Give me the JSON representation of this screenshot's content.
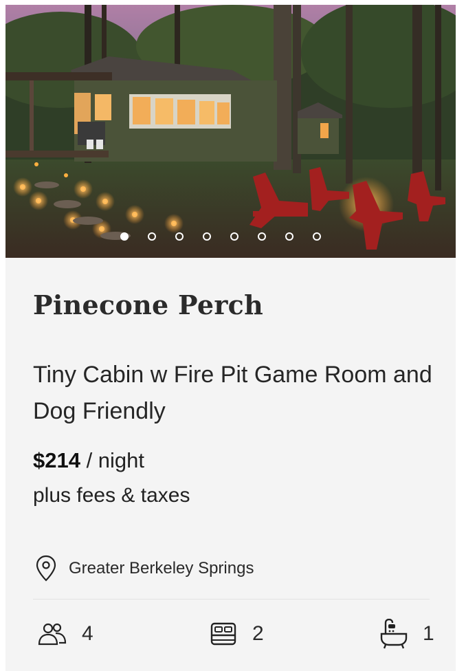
{
  "listing": {
    "name": "Pinecone Perch",
    "description": "Tiny Cabin w Fire Pit Game Room and Dog Friendly",
    "price": {
      "amount": "$214",
      "unit": " / night",
      "fees_note": "plus fees & taxes"
    },
    "location": {
      "icon": "map-pin-icon",
      "text": "Greater Berkeley Springs"
    },
    "amenities": {
      "guests": {
        "icon": "guests-icon",
        "value": "4"
      },
      "bedrooms": {
        "icon": "bed-icon",
        "value": "2"
      },
      "bathrooms": {
        "icon": "bathtub-icon",
        "value": "1"
      }
    }
  },
  "carousel": {
    "image_alt": "Cabin at dusk with red adirondack chairs around fire pit",
    "total_slides": 8,
    "active_index": 0
  },
  "colors": {
    "card_background": "#f4f4f4",
    "text": "#262626",
    "accent_chairs": "#a3201f"
  }
}
